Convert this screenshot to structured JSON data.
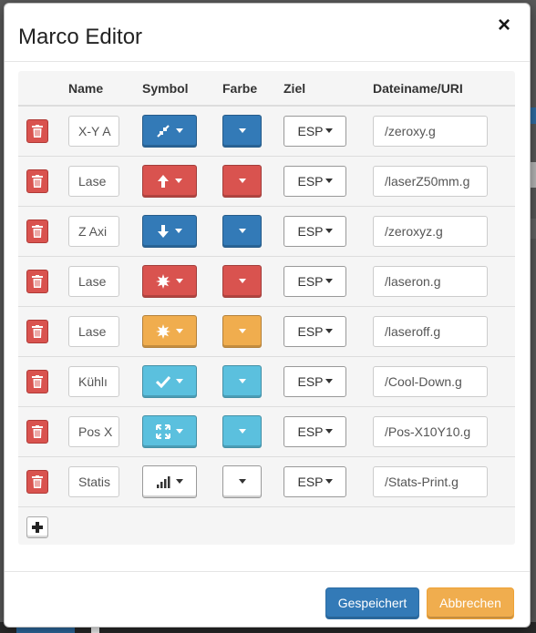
{
  "dialog": {
    "title": "Marco Editor",
    "close_glyph": "×"
  },
  "table": {
    "headers": {
      "name": "Name",
      "symbol": "Symbol",
      "color": "Farbe",
      "target": "Ziel",
      "file": "Dateiname/URI"
    },
    "rows": [
      {
        "name": "X-Y A",
        "symbol_icon": "compress-icon",
        "button_color": "blue",
        "color_swatch": "blue",
        "target": "ESP",
        "file": "/zeroxy.g"
      },
      {
        "name": "Lase",
        "symbol_icon": "arrow-up-icon",
        "button_color": "red",
        "color_swatch": "red",
        "target": "ESP",
        "file": "/laserZ50mm.g"
      },
      {
        "name": "Z Axi",
        "symbol_icon": "arrow-down-icon",
        "button_color": "blue",
        "color_swatch": "blue",
        "target": "ESP",
        "file": "/zeroxyz.g"
      },
      {
        "name": "Lase",
        "symbol_icon": "certificate-icon",
        "button_color": "red",
        "color_swatch": "red",
        "target": "ESP",
        "file": "/laseron.g"
      },
      {
        "name": "Lase",
        "symbol_icon": "certificate-icon",
        "button_color": "orange",
        "color_swatch": "orange",
        "target": "ESP",
        "file": "/laseroff.g"
      },
      {
        "name": "Kühlı",
        "symbol_icon": "checkmark-icon",
        "button_color": "cyan",
        "color_swatch": "cyan",
        "target": "ESP",
        "file": "/Cool-Down.g"
      },
      {
        "name": "Pos X",
        "symbol_icon": "fullscreen-icon",
        "button_color": "cyan",
        "color_swatch": "cyan",
        "target": "ESP",
        "file": "/Pos-X10Y10.g"
      },
      {
        "name": "Statis",
        "symbol_icon": "signal-bars-icon",
        "button_color": "white",
        "color_swatch": "white",
        "target": "ESP",
        "file": "/Stats-Print.g"
      }
    ],
    "add_icon": "plus-icon",
    "delete_icon": "trash-icon"
  },
  "colors": {
    "blue": "#337ab7",
    "red": "#d9534f",
    "orange": "#f0ad4e",
    "cyan": "#5bc0de",
    "white": "#ffffff"
  },
  "footer": {
    "save_label": "Gespeichert",
    "cancel_label": "Abbrechen"
  }
}
